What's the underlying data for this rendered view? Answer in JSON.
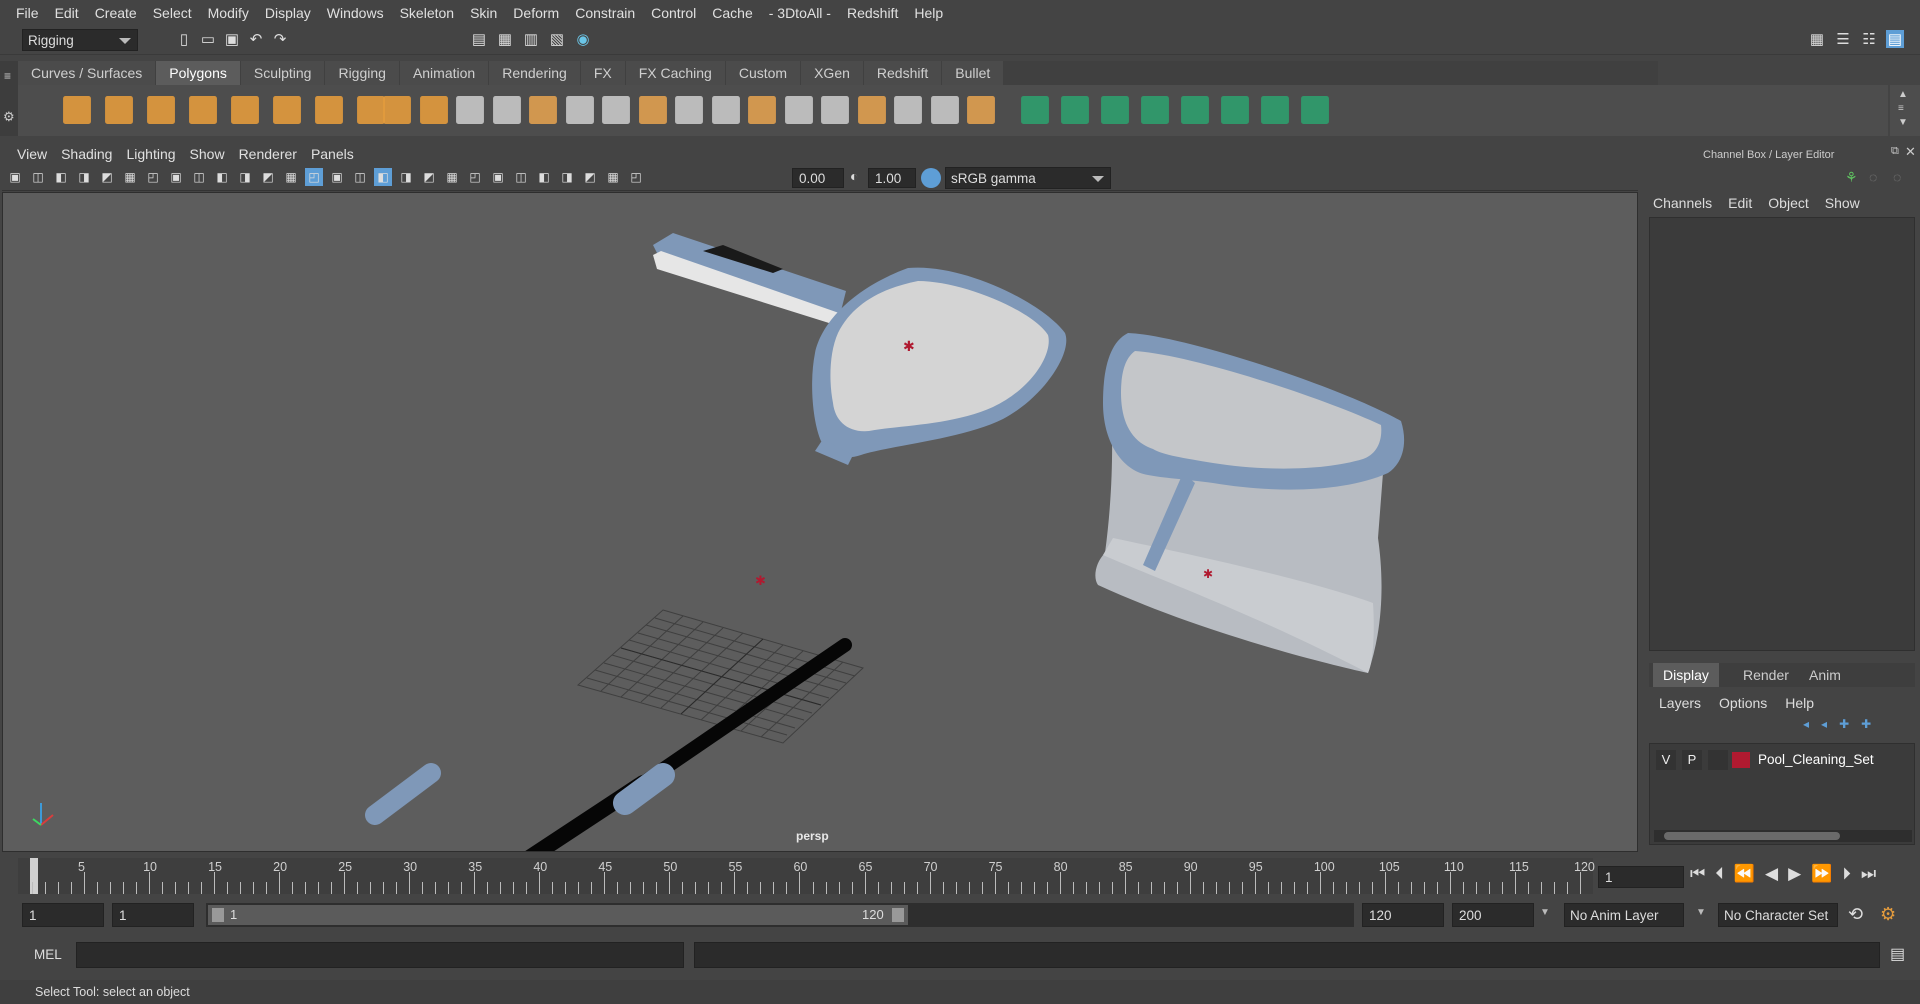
{
  "menu": [
    "File",
    "Edit",
    "Create",
    "Select",
    "Modify",
    "Display",
    "Windows",
    "Skeleton",
    "Skin",
    "Deform",
    "Constrain",
    "Control",
    "Cache",
    "- 3DtoAll -",
    "Redshift",
    "Help"
  ],
  "status": {
    "mode": "Rigging"
  },
  "shelf_tabs": [
    "Curves / Surfaces",
    "Polygons",
    "Sculpting",
    "Rigging",
    "Animation",
    "Rendering",
    "FX",
    "FX Caching",
    "Custom",
    "XGen",
    "Redshift",
    "Bullet"
  ],
  "shelf_active": "Polygons",
  "viewport": {
    "menu": [
      "View",
      "Shading",
      "Lighting",
      "Show",
      "Renderer",
      "Panels"
    ],
    "exposure": "0.00",
    "gamma": "1.00",
    "color_space": "sRGB gamma",
    "camera": "persp"
  },
  "channel_box": {
    "title": "Channel Box / Layer Editor",
    "menu": [
      "Channels",
      "Edit",
      "Object",
      "Show"
    ]
  },
  "layer_editor": {
    "tabs": [
      "Display",
      "Render",
      "Anim"
    ],
    "active_tab": "Display",
    "menu": [
      "Layers",
      "Options",
      "Help"
    ],
    "layers": [
      {
        "v": "V",
        "p": "P",
        "name": "Pool_Cleaning_Set",
        "color": "#b01a30"
      }
    ]
  },
  "timeline": {
    "ticks": [
      5,
      10,
      15,
      20,
      25,
      30,
      35,
      40,
      45,
      50,
      55,
      60,
      65,
      70,
      75,
      80,
      85,
      90,
      95,
      100,
      105,
      110,
      115,
      120
    ],
    "first_label": "1",
    "current_frame": "1"
  },
  "range": {
    "start": "1",
    "anim_start": "1",
    "slider_start": "1",
    "slider_end": "120",
    "end": "120",
    "anim_end": "200",
    "anim_layer": "No Anim Layer",
    "char_set": "No Character Set"
  },
  "command": {
    "lang": "MEL"
  },
  "help_line": "Select Tool: select an object",
  "colors": {
    "accent": "#5e9ed6",
    "mesh_blue": "#7f98b8",
    "layer_color": "#b01a30"
  }
}
